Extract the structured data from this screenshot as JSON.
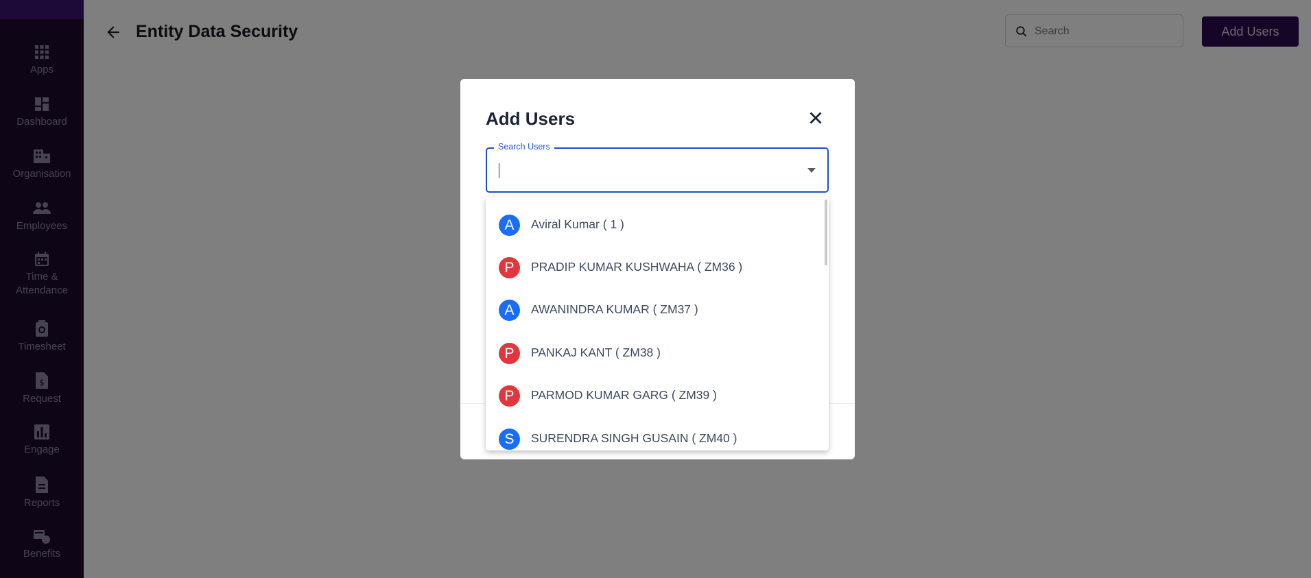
{
  "sidebar": {
    "items": [
      {
        "label": "Apps",
        "icon": "apps-grid-icon"
      },
      {
        "label": "Dashboard",
        "icon": "dashboard-icon"
      },
      {
        "label": "Organisation",
        "icon": "organisation-icon"
      },
      {
        "label": "Employees",
        "icon": "employees-icon"
      },
      {
        "label": "Time &",
        "label2": "Attendance",
        "icon": "calendar-icon"
      },
      {
        "label": "Timesheet",
        "icon": "timesheet-icon"
      },
      {
        "label": "Request",
        "icon": "request-icon"
      },
      {
        "label": "Engage",
        "icon": "engage-icon"
      },
      {
        "label": "Reports",
        "icon": "reports-icon"
      },
      {
        "label": "Benefits",
        "icon": "benefits-icon"
      }
    ]
  },
  "header": {
    "title": "Entity Data Security",
    "search_placeholder": "Search",
    "add_users_label": "Add Users"
  },
  "modal": {
    "title": "Add Users",
    "search_label": "Search Users",
    "search_value": "",
    "options": [
      {
        "initial": "A",
        "label": "Aviral Kumar ( 1 )",
        "color": "#1a6ef5"
      },
      {
        "initial": "P",
        "label": "PRADIP KUMAR KUSHWAHA ( ZM36 )",
        "color": "#e0363c"
      },
      {
        "initial": "A",
        "label": "AWANINDRA KUMAR ( ZM37 )",
        "color": "#1a6ef5"
      },
      {
        "initial": "P",
        "label": "PANKAJ KANT ( ZM38 )",
        "color": "#e0363c"
      },
      {
        "initial": "P",
        "label": "PARMOD KUMAR GARG ( ZM39 )",
        "color": "#e0363c"
      },
      {
        "initial": "S",
        "label": "SURENDRA SINGH GUSAIN ( ZM40 )",
        "color": "#1a6ef5"
      }
    ]
  },
  "colors": {
    "sidebar_bg": "#1c0b2e",
    "accent": "#2b0a4d",
    "focus_blue": "#1e4ec3"
  }
}
